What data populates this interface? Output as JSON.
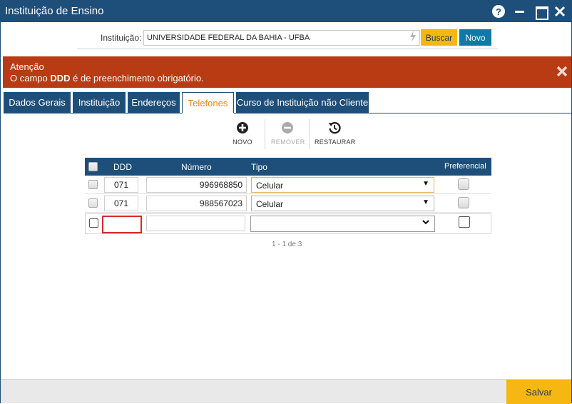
{
  "window": {
    "title": "Instituição de Ensino",
    "help_label": "?"
  },
  "search": {
    "label": "Instituição:",
    "value": "UNIVERSIDADE FEDERAL DA BAHIA - UFBA",
    "buscar_label": "Buscar",
    "novo_label": "Novo"
  },
  "alert": {
    "title": "Atenção",
    "msg_prefix": "O campo ",
    "msg_field": "DDD",
    "msg_suffix": " é de preenchimento obrigatório.",
    "color": "#b83b14"
  },
  "tabs": [
    {
      "label": "Dados Gerais"
    },
    {
      "label": "Instituição"
    },
    {
      "label": "Endereços"
    },
    {
      "label": "Telefones",
      "active": true
    },
    {
      "label": "Curso de Instituição não Cliente"
    }
  ],
  "toolbar": {
    "novo_label": "NOVO",
    "remover_label": "REMOVER",
    "restaurar_label": "RESTAURAR"
  },
  "grid": {
    "columns": [
      "DDD",
      "Número",
      "Tipo",
      "Preferencial"
    ],
    "rows": [
      {
        "ddd": "071",
        "numero": "996968850",
        "tipo": "Celular"
      },
      {
        "ddd": "071",
        "numero": "988567023",
        "tipo": "Celular"
      },
      {
        "ddd": "",
        "numero": "",
        "tipo": ""
      }
    ],
    "pager": "1 - 1 de 3"
  },
  "footer": {
    "salvar_label": "Salvar"
  },
  "colors": {
    "header_blue": "#1e4f7a",
    "accent_yellow": "#f6b712",
    "accent_teal": "#0f7aa8",
    "error_red": "#b83b14",
    "active_tab_text": "#e8891d"
  }
}
